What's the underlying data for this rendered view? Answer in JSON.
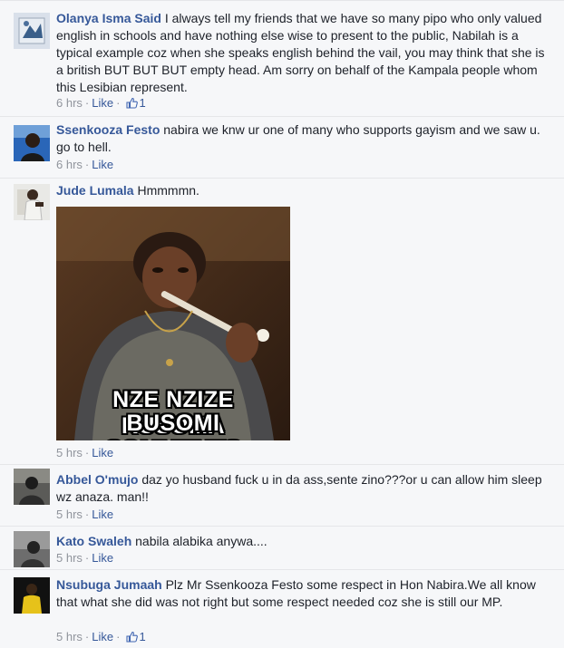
{
  "comments": [
    {
      "author": "Olanya Isma Said",
      "text": "I always tell my friends that we have so many pipo who only valued english in schools and have nothing else wise to present to the public, Nabilah is a typical example coz when she speaks english behind the vail, you may think that she is a british BUT BUT BUT empty head. Am sorry on behalf of the Kampala people whom this Lesibian represent.",
      "time": "6 hrs",
      "like_label": "Like",
      "likes": "1"
    },
    {
      "author": "Ssenkooza Festo",
      "text": "nabira we knw ur one of many who supports gayism and we saw u. go to hell.",
      "time": "6 hrs",
      "like_label": "Like"
    },
    {
      "author": "Jude Lumala",
      "text": "Hmmmmn.",
      "time": "5 hrs",
      "like_label": "Like",
      "meme": {
        "line1": "NZE NZIZE KUSOMA",
        "line2": "BUSOMI COMMENTS"
      }
    },
    {
      "author": "Abbel O'mujo",
      "text": "daz yo husband fuck u in da ass,sente zino???or u can allow him sleep wz anaza. man!!",
      "time": "5 hrs",
      "like_label": "Like"
    },
    {
      "author": "Kato Swaleh",
      "text": "nabila alabika anywa....",
      "time": "5 hrs",
      "like_label": "Like"
    },
    {
      "author": "Nsubuga Jumaah",
      "text": "Plz Mr Ssenkooza Festo some respect in Hon Nabira.We all know that what she did was not right but some respect needed coz she is still our MP.",
      "time": "5 hrs",
      "like_label": "Like",
      "likes": "1"
    }
  ],
  "separator": "·",
  "icons": {
    "like_count": "thumbs-up-icon"
  },
  "colors": {
    "link": "#365899",
    "meta": "#90949c",
    "background": "#f6f7f9"
  }
}
